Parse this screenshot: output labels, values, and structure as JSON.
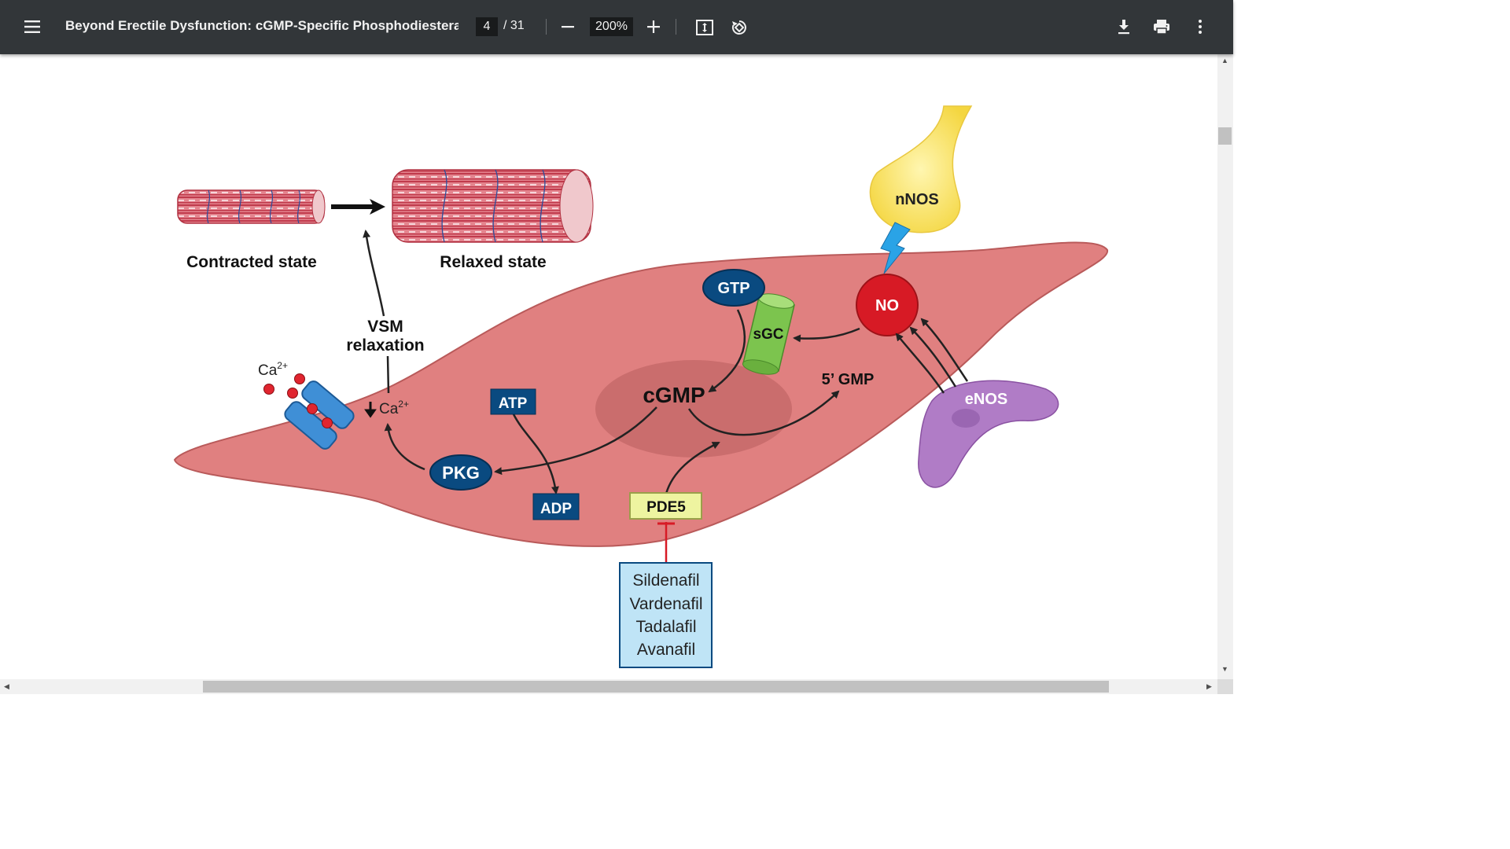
{
  "toolbar": {
    "title": "Beyond Erectile Dysfunction: cGMP-Specific Phosphodiesteras...",
    "page_current": "4",
    "page_total": "/ 31",
    "zoom": "200%"
  },
  "icons": {
    "menu": "hamburger-menu-icon",
    "zoom_out": "minus-icon",
    "zoom_in": "plus-icon",
    "fit": "fit-to-page-icon",
    "rotate": "rotate-icon",
    "download": "download-icon",
    "print": "print-icon",
    "more": "more-vertical-icon"
  },
  "figure": {
    "contracted_label": "Contracted state",
    "relaxed_label": "Relaxed state",
    "vsm_line1": "VSM",
    "vsm_line2": "relaxation",
    "ca_out": "Ca",
    "ca_out_sup": "2+",
    "ca_in": "Ca",
    "ca_in_sup": "2+",
    "gtp": "GTP",
    "sgc": "sGC",
    "no": "NO",
    "nnos": "nNOS",
    "enos": "eNOS",
    "cgmp": "cGMP",
    "gmp5": "5’ GMP",
    "atp": "ATP",
    "adp": "ADP",
    "pkg": "PKG",
    "pde5": "PDE5",
    "drugs": [
      "Sildenafil",
      "Vardenafil",
      "Tadalafil",
      "Avanafil"
    ]
  },
  "colors": {
    "toolbar_bg": "#323639",
    "cell_fill": "#e08080",
    "nucleus": "#c86a6a",
    "dark_blue": "#0a4a80",
    "no_red": "#d71a25",
    "sgc_green": "#7cc44e",
    "enos_purple": "#b07cc6",
    "nnos_yellow": "#f7e25e",
    "pde5_fill": "#eef4a0",
    "drug_box": "#bfe4f6"
  }
}
